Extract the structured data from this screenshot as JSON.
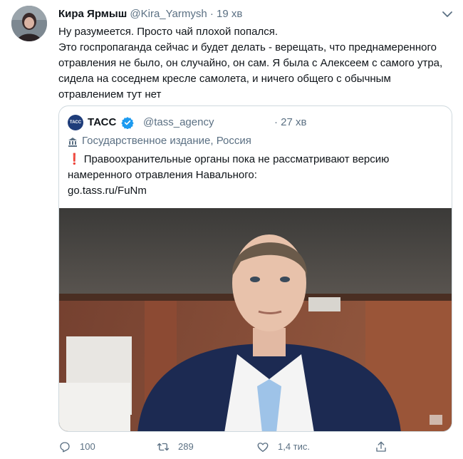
{
  "tweet": {
    "author_name": "Кира Ярмыш",
    "author_handle": "@Kira_Yarmysh",
    "separator": "·",
    "time": "19 хв",
    "text": "Ну разумеется. Просто чай плохой попался.\nЭто госпропаганда сейчас и будет делать - верещать, что преднамеренного отравления не было, он случайно, он сам. Я была с Алексеем с самого утра, сидела на соседнем кресле самолета, и ничего общего с обычным отравлением тут нет"
  },
  "quote": {
    "avatar_text": "ТАСС",
    "name": "ТАСС",
    "handle": "@tass_agency",
    "time": "· 27 хв",
    "label": "Государственное издание, Россия",
    "text": "Правоохранительные органы пока не рассматривают версию намеренного отравления Навального:",
    "bang": "❗",
    "link": "go.tass.ru/FuNm"
  },
  "actions": {
    "reply_count": "100",
    "retweet_count": "289",
    "like_count": "1,4 тис."
  },
  "icons": {
    "chevron": "chevron-down-icon",
    "verified": "verified-badge-icon",
    "building": "building-icon",
    "reply": "reply-icon",
    "retweet": "retweet-icon",
    "like": "heart-icon",
    "share": "share-icon"
  },
  "colors": {
    "secondary_text": "#5b7083",
    "verified": "#1d9bf0",
    "border": "#cfd9de"
  }
}
